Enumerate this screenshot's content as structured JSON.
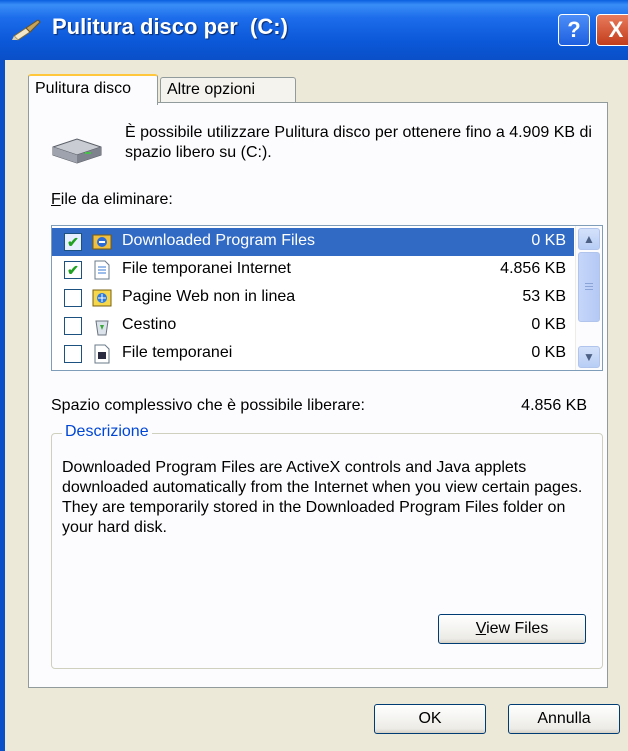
{
  "window": {
    "title": "Pulitura disco per  (C:)",
    "help_label": "?",
    "close_label": "X"
  },
  "tabs": [
    {
      "label": "Pulitura disco",
      "active": true
    },
    {
      "label": "Altre opzioni",
      "active": false
    }
  ],
  "intro_text": "È possibile utilizzare Pulitura disco per ottenere fino a 4.909 KB di spazio libero su  (C:).",
  "files_label": {
    "accel": "F",
    "rest": "ile da eliminare:"
  },
  "files": [
    {
      "name": "Downloaded Program Files",
      "size": "0 KB",
      "checked": true,
      "selected": true,
      "icon": "activex-icon"
    },
    {
      "name": "File temporanei Internet",
      "size": "4.856 KB",
      "checked": true,
      "selected": false,
      "icon": "internet-file-icon"
    },
    {
      "name": "Pagine Web non in linea",
      "size": "53 KB",
      "checked": false,
      "selected": false,
      "icon": "offline-web-icon"
    },
    {
      "name": "Cestino",
      "size": "0 KB",
      "checked": false,
      "selected": false,
      "icon": "recycle-bin-icon"
    },
    {
      "name": "File temporanei",
      "size": "0 KB",
      "checked": false,
      "selected": false,
      "icon": "temp-file-icon"
    }
  ],
  "total": {
    "label": "Spazio complessivo che è possibile liberare:",
    "value": "4.856 KB"
  },
  "description": {
    "title": "Descrizione",
    "text": "Downloaded Program Files are ActiveX controls and Java applets downloaded automatically from the Internet when you view certain pages. They are temporarily stored in the Downloaded Program Files folder on your hard disk."
  },
  "buttons": {
    "view_files": {
      "accel": "V",
      "rest": "iew Files"
    },
    "ok": "OK",
    "cancel": "Annulla"
  },
  "colors": {
    "titlebar": "#0A5FE0",
    "selection": "#316AC5",
    "dialog_bg": "#ECE9D8",
    "group_title": "#0046D5"
  }
}
